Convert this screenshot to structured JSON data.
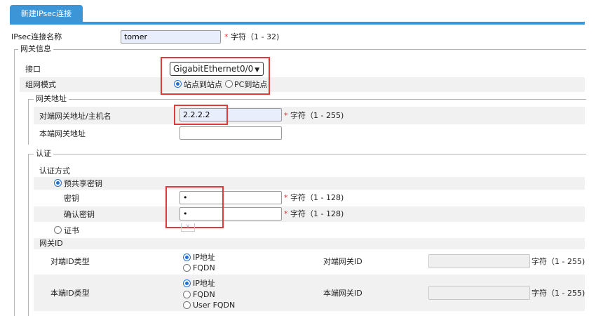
{
  "tab": {
    "label": "新建IPsec连接"
  },
  "conn_name": {
    "label": "IPsec连接名称",
    "value": "tomer",
    "hint": "字符（1 - 32)"
  },
  "gateway": {
    "legend": "网关信息",
    "interface": {
      "label": "接口",
      "value": "GigabitEthernet0/0"
    },
    "mode": {
      "label": "组网模式",
      "options": [
        "站点到站点",
        "PC到站点"
      ],
      "selected": "站点到站点"
    },
    "address": {
      "legend": "网关地址",
      "peer": {
        "label": "对端网关地址/主机名",
        "value": "2.2.2.2",
        "hint": "字符（1 - 255)"
      },
      "local": {
        "label": "本端网关地址",
        "value": ""
      }
    }
  },
  "auth": {
    "legend": "认证",
    "method_label": "认证方式",
    "psk_label": "预共享密钥",
    "key": {
      "label": "密钥",
      "value": "•",
      "hint": "字符（1 - 128)"
    },
    "confirm": {
      "label": "确认密钥",
      "value": "•",
      "hint": "字符（1 - 128)"
    },
    "cert_label": "证书",
    "gateway_id": {
      "title": "网关ID",
      "peer_type": {
        "label": "对端ID类型",
        "options": [
          "IP地址",
          "FQDN"
        ],
        "selected": "IP地址"
      },
      "peer_gw": {
        "label": "对端网关ID",
        "hint": "字符（1 - 255)"
      },
      "local_type": {
        "label": "本端ID类型",
        "options": [
          "IP地址",
          "FQDN",
          "User FQDN"
        ],
        "selected": "IP地址"
      },
      "local_gw": {
        "label": "本端网关ID",
        "hint": "字符（1 - 255)"
      }
    }
  },
  "required_mark": "*"
}
